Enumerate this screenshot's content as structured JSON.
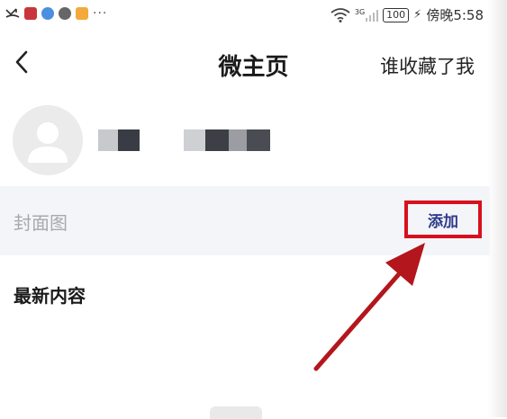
{
  "status_bar": {
    "carrier_time": "傍晚5:58",
    "battery": "100",
    "network": "3G",
    "notification_dots": "···",
    "icons": [
      "missed-call-icon",
      "app-notify-icon",
      "browser-icon",
      "settings-icon",
      "file-icon"
    ]
  },
  "header": {
    "back_icon": "chevron-left-icon",
    "title": "微主页",
    "right_link": "谁收藏了我"
  },
  "profile": {
    "avatar_icon": "default-avatar-icon"
  },
  "cover": {
    "label": "封面图",
    "add_button": "添加"
  },
  "content": {
    "section_title": "最新内容"
  },
  "colors": {
    "highlight_box": "#d8101e",
    "annotation_arrow": "#b3161c",
    "add_text": "#2e3a8c",
    "row_background": "#f4f5f8"
  }
}
